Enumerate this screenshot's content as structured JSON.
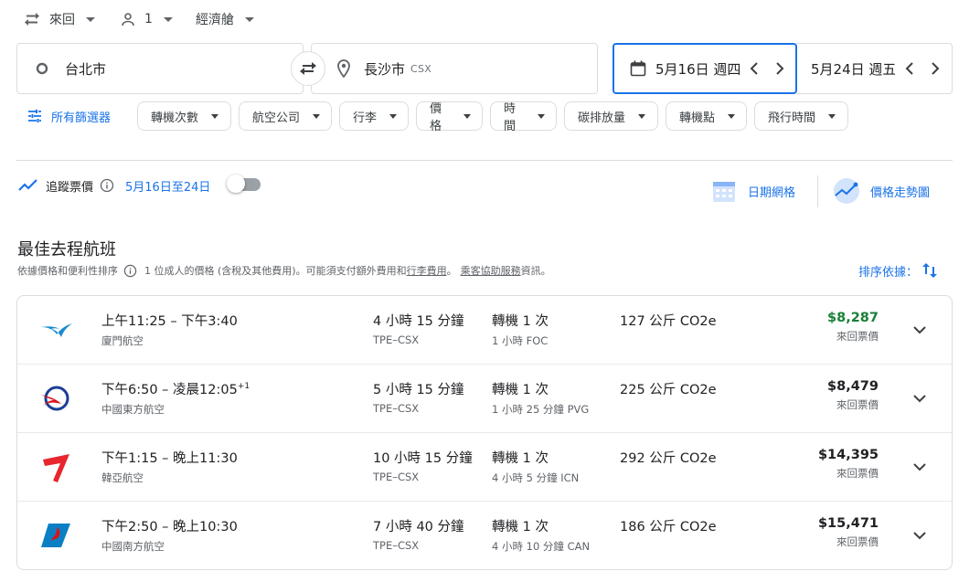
{
  "top_bar": {
    "trip_type": "來回",
    "passengers": "1",
    "cabin": "經濟艙"
  },
  "search": {
    "origin": "台北市",
    "destination": "長沙市",
    "destination_code": "CSX",
    "depart_date": "5月16日 週四",
    "return_date": "5月24日 週五"
  },
  "filters": {
    "all_filters": "所有篩選器",
    "chips": [
      "轉機次數",
      "航空公司",
      "行李",
      "價格",
      "時間",
      "碳排放量",
      "轉機點",
      "飛行時間"
    ]
  },
  "tracking": {
    "label": "追蹤票價",
    "dates": "5月16日至24日",
    "date_grid": "日期網格",
    "price_graph": "價格走勢圖"
  },
  "results": {
    "title": "最佳去程航班",
    "note_a": "依據價格和便利性排序",
    "note_b": "1 位成人的價格 (含稅及其他費用)。可能須支付額外費用和",
    "note_link1": "行李費用",
    "note_c": "。",
    "note_link2": "乘客協助服務",
    "note_d": "資訊。",
    "sort_label": "排序依據：",
    "flights": [
      {
        "times": "上午11:25 – 下午3:40",
        "day_offset": "",
        "airline": "廈門航空",
        "duration": "4 小時 15 分鐘",
        "route": "TPE–CSX",
        "stops": "轉機 1 次",
        "layover": "1 小時 FOC",
        "emissions": "127 公斤 CO2e",
        "price": "$8,287",
        "price_label": "來回票價",
        "price_color": "#188038"
      },
      {
        "times": "下午6:50 – 凌晨12:05",
        "day_offset": "+1",
        "airline": "中國東方航空",
        "duration": "5 小時 15 分鐘",
        "route": "TPE–CSX",
        "stops": "轉機 1 次",
        "layover": "1 小時 25 分鐘 PVG",
        "emissions": "225 公斤 CO2e",
        "price": "$8,479",
        "price_label": "來回票價",
        "price_color": "#202124"
      },
      {
        "times": "下午1:15 – 晚上11:30",
        "day_offset": "",
        "airline": "韓亞航空",
        "duration": "10 小時 15 分鐘",
        "route": "TPE–CSX",
        "stops": "轉機 1 次",
        "layover": "4 小時 5 分鐘 ICN",
        "emissions": "292 公斤 CO2e",
        "price": "$14,395",
        "price_label": "來回票價",
        "price_color": "#202124"
      },
      {
        "times": "下午2:50 – 晚上10:30",
        "day_offset": "",
        "airline": "中國南方航空",
        "duration": "7 小時 40 分鐘",
        "route": "TPE–CSX",
        "stops": "轉機 1 次",
        "layover": "4 小時 10 分鐘 CAN",
        "emissions": "186 公斤 CO2e",
        "price": "$15,471",
        "price_label": "來回票價",
        "price_color": "#202124"
      }
    ]
  },
  "colors": {
    "accent": "#1a73e8",
    "border": "#dadce0",
    "price_green": "#188038"
  }
}
